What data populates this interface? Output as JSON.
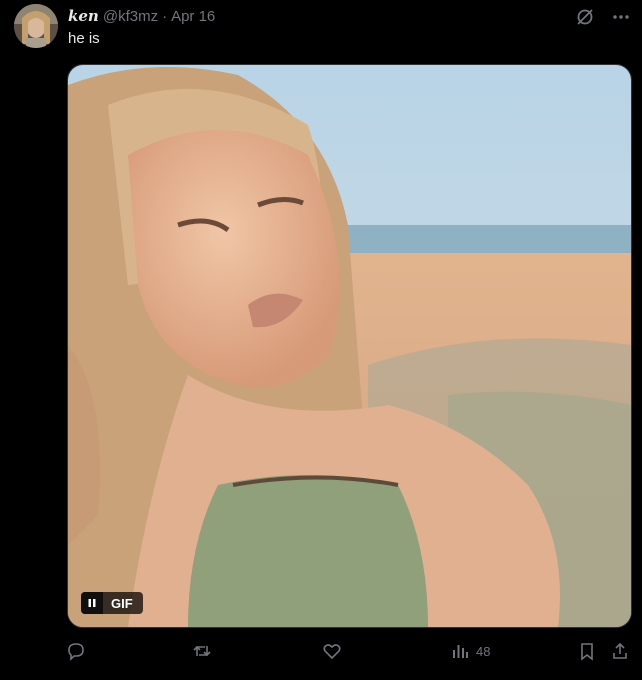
{
  "tweet": {
    "display_name": "ken",
    "handle": "@kf3mz",
    "separator": "·",
    "date": "Apr 16",
    "text": "he is"
  },
  "media": {
    "badge_label": "GIF",
    "pause_icon": "pause-icon"
  },
  "top_actions": [
    "grok-icon",
    "more-icon"
  ],
  "actions": {
    "reply_icon": "reply-icon",
    "retweet_icon": "retweet-icon",
    "like_icon": "heart-icon",
    "views_icon": "views-icon",
    "views": "48",
    "bookmark_icon": "bookmark-icon",
    "share_icon": "share-icon"
  },
  "colors": {
    "background": "#000000",
    "text_primary": "#e7e9ea",
    "text_secondary": "#71767b",
    "border": "#2f3336"
  }
}
